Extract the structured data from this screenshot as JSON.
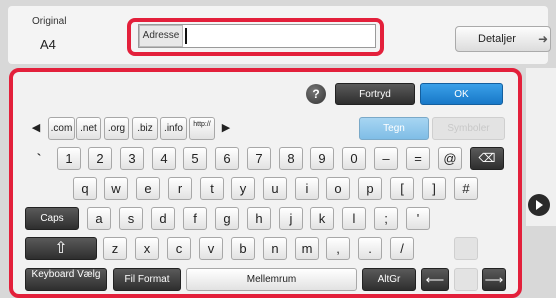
{
  "header": {
    "original_label": "Original",
    "original_value": "A4",
    "address_tag": "Adresse",
    "address_value": "",
    "detail_label": "Detaljer",
    "detail_arrow": "➜"
  },
  "keyboard": {
    "help": "?",
    "undo": "Fortryd",
    "ok": "OK",
    "domains": [
      ".com",
      ".net",
      ".org",
      ".biz",
      ".info",
      "http://"
    ],
    "left_arrow": "◀",
    "right_arrow": "▶",
    "tab_tegn": "Tegn",
    "tab_symboler": "Symboler",
    "row1": [
      "`",
      "1",
      "2",
      "3",
      "4",
      "5",
      "6",
      "7",
      "8",
      "9",
      "0",
      "–",
      "=",
      "@"
    ],
    "row2": [
      "q",
      "w",
      "e",
      "r",
      "t",
      "y",
      "u",
      "i",
      "o",
      "p",
      "[",
      "]",
      "#"
    ],
    "row3": [
      "a",
      "s",
      "d",
      "f",
      "g",
      "h",
      "j",
      "k",
      "l",
      ";",
      "'"
    ],
    "row4": [
      "z",
      "x",
      "c",
      "v",
      "b",
      "n",
      "m",
      ",",
      ".",
      "/"
    ],
    "caps": "Caps",
    "shift": "⇧",
    "keyboard_select": "Keyboard Vælg",
    "file_format": "Fil Format",
    "space": "Mellemrum",
    "altgr": "AltGr",
    "cursor_left": "⟵",
    "cursor_right": "⟶",
    "backspace": "⌫"
  }
}
